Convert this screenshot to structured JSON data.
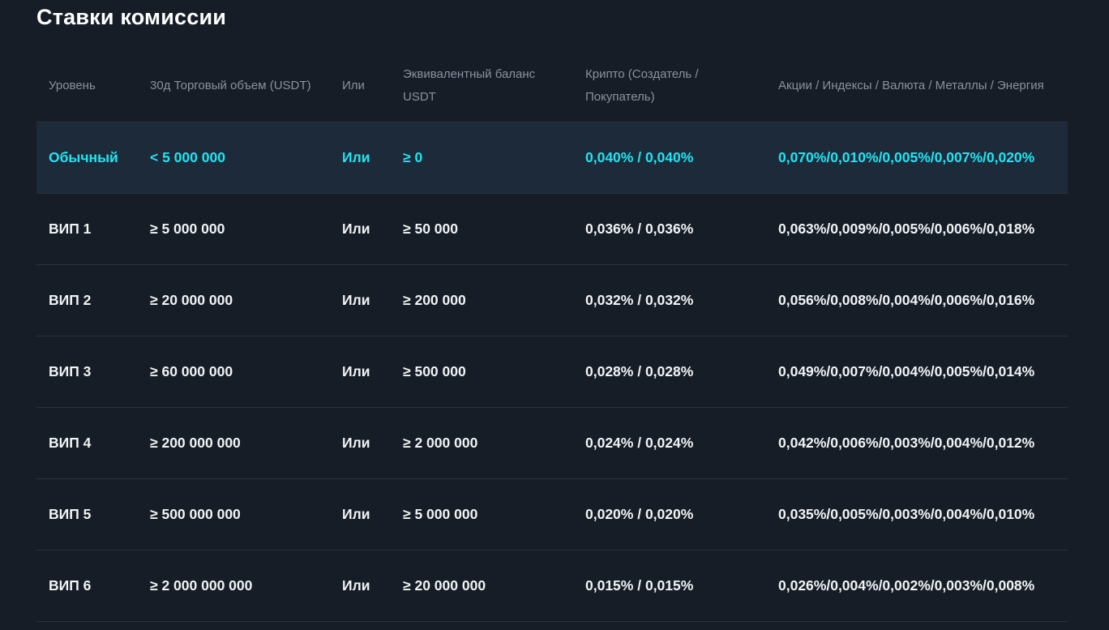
{
  "page": {
    "title": "Ставки комиссии"
  },
  "table": {
    "headers": {
      "level": "Уровень",
      "volume": "30д Торговый объем (USDT)",
      "or": "Или",
      "balance": "Эквивалентный баланс USDT",
      "crypto": "Крипто (Создатель / Покупатель)",
      "stocks": "Акции / Индексы / Валюта / Металлы / Энергия"
    },
    "rows": [
      {
        "level": "Обычный",
        "volume": "< 5 000 000",
        "or": "Или",
        "balance": "≥ 0",
        "crypto": "0,040% / 0,040%",
        "stocks": "0,070%/0,010%/0,005%/0,007%/0,020%"
      },
      {
        "level": "ВИП 1",
        "volume": "≥ 5 000 000",
        "or": "Или",
        "balance": "≥ 50 000",
        "crypto": "0,036% / 0,036%",
        "stocks": "0,063%/0,009%/0,005%/0,006%/0,018%"
      },
      {
        "level": "ВИП 2",
        "volume": "≥ 20 000 000",
        "or": "Или",
        "balance": "≥ 200 000",
        "crypto": "0,032% / 0,032%",
        "stocks": "0,056%/0,008%/0,004%/0,006%/0,016%"
      },
      {
        "level": "ВИП 3",
        "volume": "≥ 60 000 000",
        "or": "Или",
        "balance": "≥ 500 000",
        "crypto": "0,028% / 0,028%",
        "stocks": "0,049%/0,007%/0,004%/0,005%/0,014%"
      },
      {
        "level": "ВИП 4",
        "volume": "≥ 200 000 000",
        "or": "Или",
        "balance": "≥ 2 000 000",
        "crypto": "0,024% / 0,024%",
        "stocks": "0,042%/0,006%/0,003%/0,004%/0,012%"
      },
      {
        "level": "ВИП 5",
        "volume": "≥ 500 000 000",
        "or": "Или",
        "balance": "≥ 5 000 000",
        "crypto": "0,020% / 0,020%",
        "stocks": "0,035%/0,005%/0,003%/0,004%/0,010%"
      },
      {
        "level": "ВИП 6",
        "volume": "≥ 2 000 000 000",
        "or": "Или",
        "balance": "≥ 20 000 000",
        "crypto": "0,015% / 0,015%",
        "stocks": "0,026%/0,004%/0,002%/0,003%/0,008%"
      }
    ]
  },
  "colors": {
    "background": "#161d27",
    "highlight_row_bg": "#1c2a3a",
    "highlight_text": "#22e4f0",
    "header_text": "#8a929e",
    "body_text": "#f1f3f5"
  }
}
